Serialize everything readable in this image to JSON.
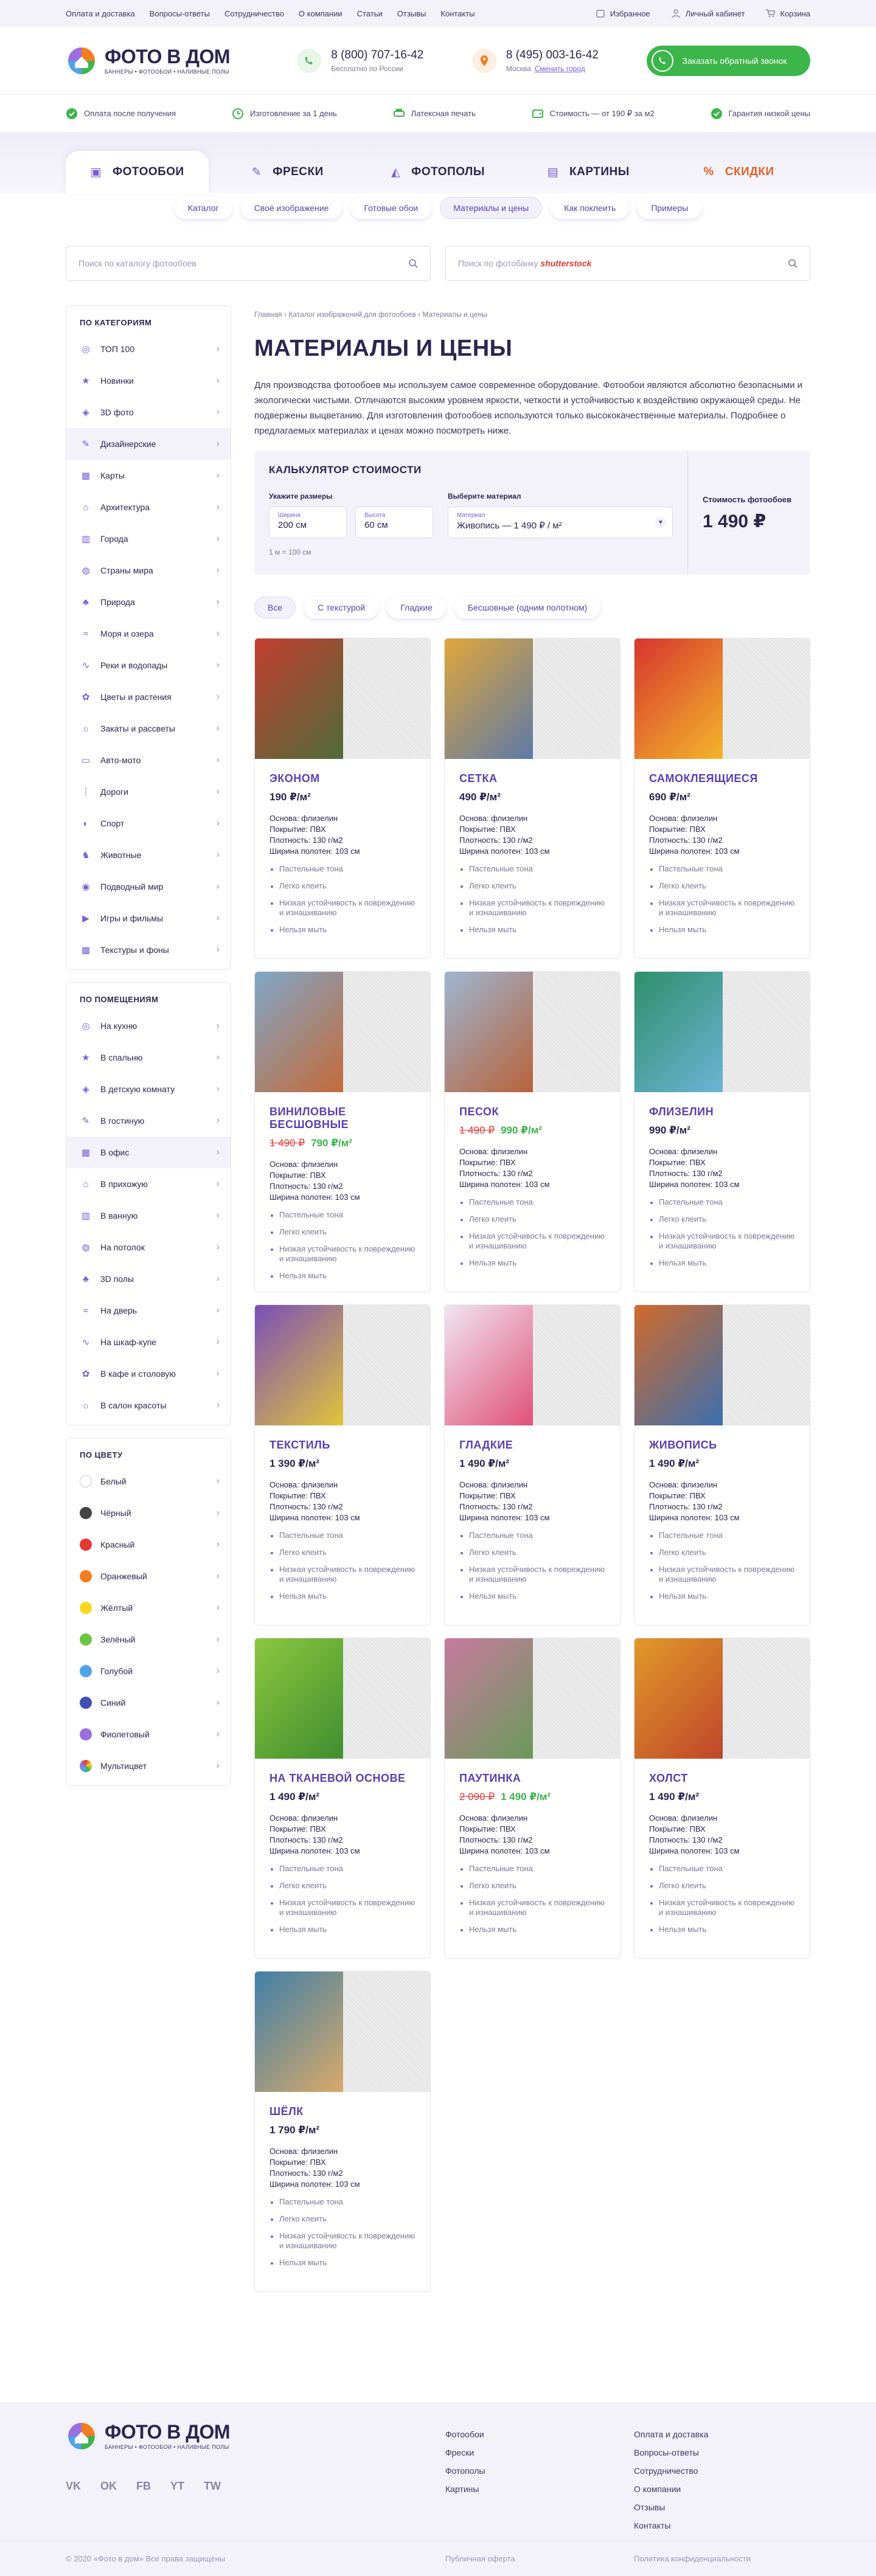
{
  "topbar": {
    "links": [
      "Оплата и доставка",
      "Вопросы-ответы",
      "Сотрудничество",
      "О компании",
      "Статьи",
      "Отзывы",
      "Контакты"
    ],
    "favorites": "Избранное",
    "account": "Личный кабинет",
    "cart": "Корзина"
  },
  "header": {
    "logo_title": "ФОТО В ДОМ",
    "logo_sub": "БАННЕРЫ • ФОТООБОИ • НАЛИВНЫЕ ПОЛЫ",
    "phone1": "8 (800) 707-16-42",
    "phone1_note": "Бесплатно по России",
    "phone2": "8 (495) 003-16-42",
    "phone2_city": "Москва",
    "change_city": "Сменить город",
    "callback": "Заказать обратный звонок"
  },
  "advantages": [
    "Оплата после получения",
    "Изготовление за 1 день",
    "Латексная печать",
    "Стоимость — от 190 ₽ за м2",
    "Гарантия низкой цены"
  ],
  "tabs": [
    "ФОТООБОИ",
    "ФРЕСКИ",
    "ФОТОПОЛЫ",
    "КАРТИНЫ",
    "СКИДКИ"
  ],
  "subnav": [
    "Каталог",
    "Своё изображение",
    "Готовые обои",
    "Материалы и цены",
    "Как поклеить",
    "Примеры"
  ],
  "search": {
    "catalog_placeholder": "Поиск по каталогу фотообоев",
    "bank_placeholder": "Поиск по фотобанку",
    "bank_brand": "shutterstock"
  },
  "sidebar": {
    "cat_title": "ПО КАТЕГОРИЯМ",
    "categories": [
      "ТОП 100",
      "Новинки",
      "3D фото",
      "Дизайнерские",
      "Карты",
      "Архитектура",
      "Города",
      "Страны мира",
      "Природа",
      "Моря и озера",
      "Реки и водопады",
      "Цветы и растения",
      "Закаты и рассветы",
      "Авто-мото",
      "Дороги",
      "Спорт",
      "Животные",
      "Подводный мир",
      "Игры и фильмы",
      "Текстуры и фоны"
    ],
    "room_title": "ПО ПОМЕЩЕНИЯМ",
    "rooms": [
      "На кухню",
      "В спальню",
      "В детскую комнату",
      "В гостиную",
      "В офис",
      "В прихожую",
      "В ванную",
      "На потолок",
      "3D полы",
      "На дверь",
      "На шкаф-купе",
      "В кафе и столовую",
      "В салон красоты"
    ],
    "color_title": "ПО ЦВЕТУ",
    "colors": [
      {
        "name": "Белый",
        "hex": "#ffffff"
      },
      {
        "name": "Чёрный",
        "hex": "#444444"
      },
      {
        "name": "Красный",
        "hex": "#e53935"
      },
      {
        "name": "Оранжевый",
        "hex": "#f57c1f"
      },
      {
        "name": "Жёлтый",
        "hex": "#f9d71c"
      },
      {
        "name": "Зелёный",
        "hex": "#6cc644"
      },
      {
        "name": "Голубой",
        "hex": "#4fa3e8"
      },
      {
        "name": "Синий",
        "hex": "#3f51b5"
      },
      {
        "name": "Фиолетовый",
        "hex": "#9c6fe0"
      },
      {
        "name": "Мультицвет",
        "hex": "#e0632a"
      }
    ]
  },
  "breadcrumb": [
    "Главная",
    "Каталог изображений для фотообоев",
    "Материалы и цены"
  ],
  "page_title": "МАТЕРИАЛЫ И ЦЕНЫ",
  "intro": "Для производства фотообоев мы используем самое современное оборудование. Фотообои являются абсолютно безопасными и экологически чистыми. Отличаются высоким уровнем яркости, четкости и устойчивостью к воздействию окружающей среды. Не подвержены выцветанию. Для изготовления фотообоев используются только высококачественные материалы. Подробнее о предлагаемых материалах и ценах можно посмотреть ниже.",
  "calculator": {
    "title": "КАЛЬКУЛЯТОР СТОИМОСТИ",
    "size_label": "Укажите размеры",
    "width_label": "Ширина",
    "width_value": "200 см",
    "height_label": "Высота",
    "height_value": "60 см",
    "material_label": "Выберите материал",
    "material_field_label": "Материал",
    "material_value": "Живопись — 1 490 ₽ / м²",
    "note": "1 м = 100 см",
    "cost_label": "Стоимость фотообоев",
    "cost_value": "1 490 ₽"
  },
  "filters": [
    "Все",
    "С текстурой",
    "Гладкие",
    "Бесшовные (одним полотном)"
  ],
  "specs": [
    "Основа: флизелин",
    "Покрытие: ПВХ",
    "Плотность: 130 г/м2",
    "Ширина полотен: 103 см"
  ],
  "features": [
    "Пастельные тона",
    "Легко клеить",
    "Низкая устойчивость к повреждению и изнашиванию",
    "Нельзя мыть"
  ],
  "products": [
    {
      "name": "ЭКОНОМ",
      "price": "190 ₽/м²",
      "old": "",
      "new": "",
      "c1": "#c33f2f",
      "c2": "#4f6b3a"
    },
    {
      "name": "СЕТКА",
      "price": "490 ₽/м²",
      "old": "",
      "new": "",
      "c1": "#e0a63a",
      "c2": "#5d7aa8"
    },
    {
      "name": "САМОКЛЕЯЩИЕСЯ",
      "price": "690 ₽/м²",
      "old": "",
      "new": "",
      "c1": "#d8352e",
      "c2": "#f2b62a"
    },
    {
      "name": "ВИНИЛОВЫЕ БЕСШОВНЫЕ",
      "price": "",
      "old": "1 490 ₽",
      "new": "790 ₽/м²",
      "c1": "#7fa7c8",
      "c2": "#c56a3a"
    },
    {
      "name": "ПЕСОК",
      "price": "",
      "old": "1 490 ₽",
      "new": "990 ₽/м²",
      "c1": "#9db6d2",
      "c2": "#b8623a"
    },
    {
      "name": "ФЛИЗЕЛИН",
      "price": "990 ₽/м²",
      "old": "",
      "new": "",
      "c1": "#2f8f6a",
      "c2": "#6bb4d6"
    },
    {
      "name": "ТЕКСТИЛЬ",
      "price": "1 390 ₽/м²",
      "old": "",
      "new": "",
      "c1": "#7a4fb8",
      "c2": "#e0c43a"
    },
    {
      "name": "ГЛАДКИЕ",
      "price": "1 490 ₽/м²",
      "old": "",
      "new": "",
      "c1": "#f0e6f0",
      "c2": "#e0507a"
    },
    {
      "name": "ЖИВОПИСЬ",
      "price": "1 490 ₽/м²",
      "old": "",
      "new": "",
      "c1": "#d06a2a",
      "c2": "#3d6fb0"
    },
    {
      "name": "НА ТКАНЕВОЙ ОСНОВЕ",
      "price": "1 490 ₽/м²",
      "old": "",
      "new": "",
      "c1": "#8cc63f",
      "c2": "#3f8f2f"
    },
    {
      "name": "ПАУТИНКА",
      "price": "",
      "old": "2 090 ₽",
      "new": "1 490 ₽/м²",
      "c1": "#c87aa0",
      "c2": "#6a9a5a"
    },
    {
      "name": "ХОЛСТ",
      "price": "1 490 ₽/м²",
      "old": "",
      "new": "",
      "c1": "#e09a2a",
      "c2": "#c0452a"
    },
    {
      "name": "ШЁЛК",
      "price": "1 790 ₽/м²",
      "old": "",
      "new": "",
      "c1": "#3f7fa8",
      "c2": "#d8a96a"
    }
  ],
  "footer": {
    "col1": [
      "Фотообои",
      "Фрески",
      "Фотополы",
      "Картины"
    ],
    "col2": [
      "Оплата и доставка",
      "Вопросы-ответы",
      "Сотрудничество",
      "О компании",
      "Отзывы",
      "Контакты"
    ],
    "social": [
      "VK",
      "OK",
      "FB",
      "YT",
      "TW"
    ],
    "copyright": "© 2020 «Фото в дом» Все права защищены",
    "offer": "Публичная оферта",
    "privacy": "Политика конфиденциальности"
  }
}
